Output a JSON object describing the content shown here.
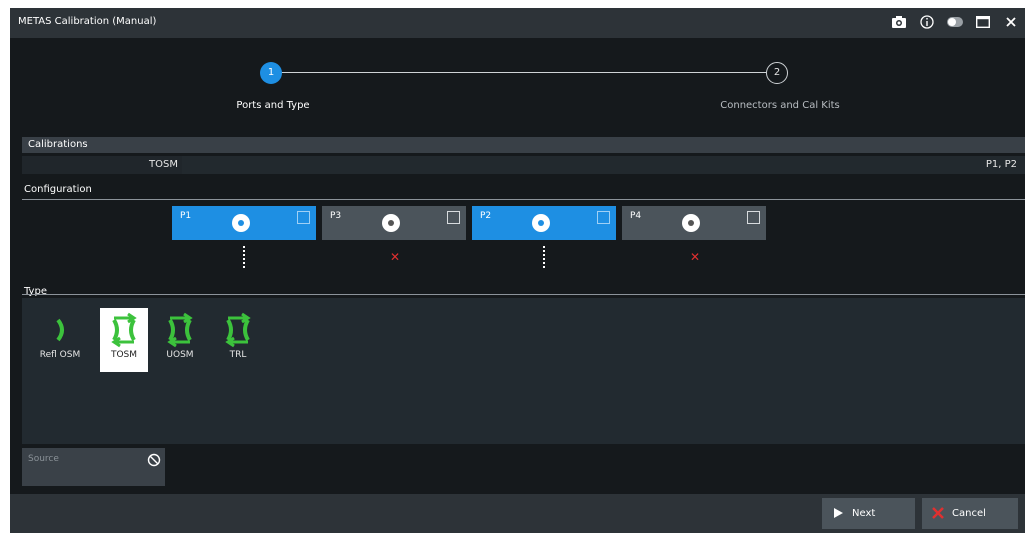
{
  "window": {
    "title": "METAS Calibration (Manual)"
  },
  "titlebar_icons": [
    "camera-icon",
    "info-icon",
    "toggle-icon",
    "maximize-icon",
    "close-icon"
  ],
  "stepper": {
    "steps": [
      {
        "number": "1",
        "label": "Ports and Type",
        "state": "active"
      },
      {
        "number": "2",
        "label": "Connectors and Cal Kits",
        "state": "pending"
      }
    ]
  },
  "calibrations": {
    "heading": "Calibrations",
    "rows": [
      {
        "name": "TOSM",
        "ports": "P1, P2"
      }
    ]
  },
  "configuration": {
    "heading": "Configuration",
    "ports": [
      {
        "label": "P1",
        "selected": true
      },
      {
        "label": "P3",
        "selected": false
      },
      {
        "label": "P2",
        "selected": true
      },
      {
        "label": "P4",
        "selected": false
      }
    ]
  },
  "type": {
    "heading": "Type",
    "items": [
      {
        "label": "Refl OSM",
        "icon": "refl-osm-icon",
        "selected": false
      },
      {
        "label": "TOSM",
        "icon": "tosm-icon",
        "selected": true
      },
      {
        "label": "UOSM",
        "icon": "uosm-icon",
        "selected": false
      },
      {
        "label": "TRL",
        "icon": "trl-icon",
        "selected": false
      }
    ]
  },
  "source": {
    "placeholder": "Source"
  },
  "buttons": {
    "next": "Next",
    "cancel": "Cancel"
  },
  "colors": {
    "accent": "#1e8fe3",
    "background": "#15191c",
    "panel": "#222a30",
    "green": "#3cc23c",
    "error": "#e03030"
  }
}
